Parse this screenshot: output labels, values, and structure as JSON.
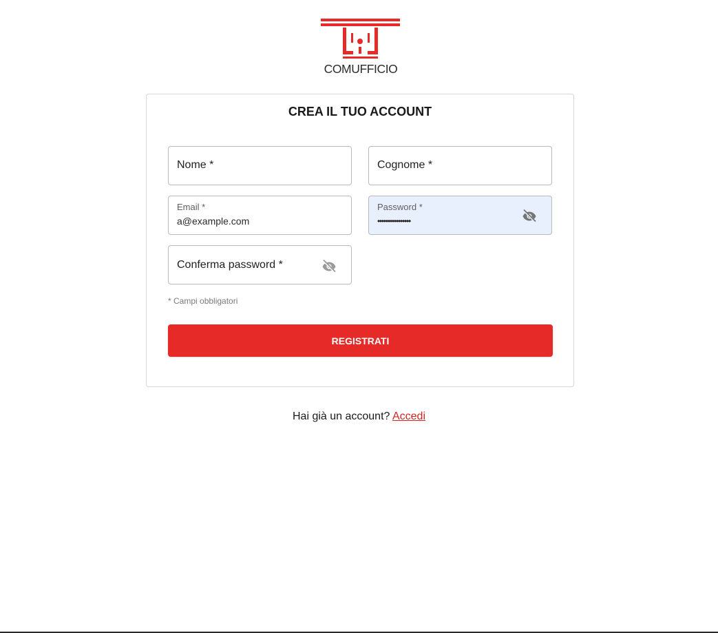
{
  "brand": {
    "name": "COMUFFICIO",
    "color": "#e62a28",
    "icon": "comufficio-logo"
  },
  "form": {
    "title": "CREA IL TUO ACCOUNT",
    "fields": {
      "first_name": {
        "label": "Nome *",
        "value": ""
      },
      "last_name": {
        "label": "Cognome *",
        "value": ""
      },
      "email": {
        "label": "Email *",
        "value": "a@example.com"
      },
      "password": {
        "label": "Password *",
        "value": "••••••••••••••••",
        "toggle_icon": "eye-off-icon"
      },
      "confirm_password": {
        "label": "Conferma password *",
        "value": "",
        "toggle_icon": "eye-off-icon"
      }
    },
    "required_note": "* Campi obbligatori",
    "submit_label": "REGISTRATI"
  },
  "footer": {
    "prompt": "Hai già un account?",
    "login_link": "Accedi"
  }
}
